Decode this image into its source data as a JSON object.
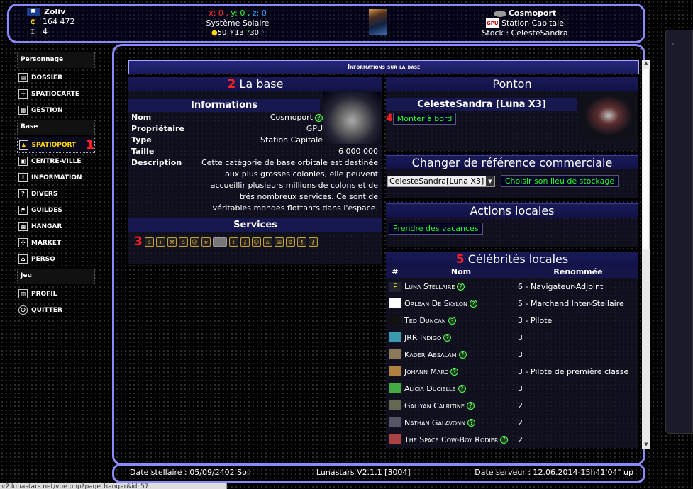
{
  "header": {
    "player_name": "Zoliv",
    "credits": "164 472",
    "level": "4",
    "coords": {
      "x_label": "x:",
      "x": "0",
      "y_label": "y:",
      "y": "0",
      "z_label": "z:",
      "z": "0"
    },
    "system": "Système Solaire",
    "res1": "50",
    "res2": "13",
    "res3": "30",
    "station_name": "Cosmoport",
    "station_owner_tag": "GPU",
    "station_type": "Station Capitale",
    "stock_label": "Stock : CelesteSandra"
  },
  "sidebar": {
    "sections": [
      {
        "label": "Personnage",
        "items": [
          "Dossier",
          "Spatiocarte",
          "Gestion"
        ]
      },
      {
        "label": "Base",
        "items": [
          "Spatioport",
          "Centre-ville",
          "Information",
          "Divers",
          "Guildes",
          "Hangar",
          "Market",
          "Perso"
        ]
      },
      {
        "label": "Jeu",
        "items": [
          "Profil",
          "Quitter"
        ]
      }
    ],
    "active_marker": "1"
  },
  "main": {
    "title": "Informations sur la base",
    "base": {
      "marker": "2",
      "title": "La base",
      "info_title": "Informations",
      "rows": [
        {
          "k": "Nom",
          "v": "Cosmoport"
        },
        {
          "k": "Propriétaire",
          "v": "GPU"
        },
        {
          "k": "Type",
          "v": "Station Capitale"
        },
        {
          "k": "Taille",
          "v": "6 000 000"
        }
      ],
      "desc_label": "Description",
      "description": "Cette catégorie de base orbitale est destinée aux plus grosses colonies, elle peuvent accueillir plusieurs millions de colons et de trés nombreux services. Ce sont de véritables mondes flottants dans l'espace.",
      "services_title": "Services",
      "services_marker": "3"
    },
    "ponton": {
      "title": "Ponton",
      "ship_name": "CelesteSandra [Luna X3]",
      "marker": "4",
      "board_button": "Monter à bord"
    },
    "ref": {
      "title": "Changer de référence commerciale",
      "selected": "CelesteSandra[Luna X3]",
      "button": "Choisir son lieu de stockage"
    },
    "actions": {
      "title": "Actions locales",
      "button": "Prendre des vacances"
    },
    "celebs": {
      "marker": "5",
      "title": "Célébrités locales",
      "headers": [
        "#",
        "Nom",
        "Renommée"
      ],
      "rows": [
        {
          "name": "Luna Stellaire",
          "fame": "6 - Navigateur-Adjoint"
        },
        {
          "name": "Orlean De Skylon",
          "fame": "5 - Marchand Inter-Stellaire"
        },
        {
          "name": "Ted Duncan",
          "fame": "3 - Pilote"
        },
        {
          "name": "JRR Indigo",
          "fame": "3"
        },
        {
          "name": "Kader Absalam",
          "fame": "3"
        },
        {
          "name": "Johann Marc",
          "fame": "3 - Pilote de première classe"
        },
        {
          "name": "Alicia Ducielle",
          "fame": "3"
        },
        {
          "name": "Gallyan Calritine",
          "fame": "2"
        },
        {
          "name": "Nathan Galavonn",
          "fame": "2"
        },
        {
          "name": "The Space Cow-Boy Rodier",
          "fame": "2"
        }
      ]
    }
  },
  "footer": {
    "date_stellaire": "Date stellaire : 05/09/2402 Soir",
    "version": "Lunastars V2.1.1 [3004]",
    "date_serveur": "Date serveur : 12.06.2014-15h41'04\" up"
  },
  "status_url": "v2.lunastars.net/vue.php?page_hangar&id_57"
}
